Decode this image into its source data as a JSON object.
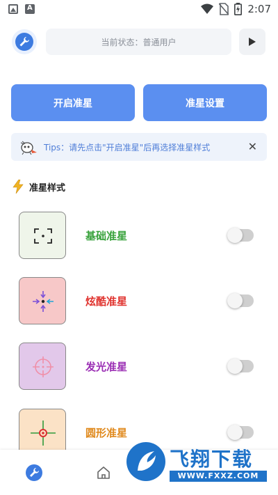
{
  "status_bar": {
    "time": "2:07",
    "icons": [
      "image-icon",
      "text-a-icon",
      "wifi-icon",
      "no-sim-icon",
      "battery-icon"
    ]
  },
  "top": {
    "status_text": "当前状态：普通用户"
  },
  "buttons": {
    "open": "开启准星",
    "settings": "准星设置"
  },
  "tips": {
    "text": "Tips：请先点击\"开启准星\"后再选择准星样式",
    "close": "✕"
  },
  "section": {
    "title": "准星样式"
  },
  "styles": [
    {
      "label": "基础准星",
      "color": "#38a23b",
      "thumb_bg": "#eff5ea",
      "enabled": false
    },
    {
      "label": "炫酷准星",
      "color": "#e0342f",
      "thumb_bg": "#f7c8c8",
      "enabled": false
    },
    {
      "label": "发光准星",
      "color": "#9b2fb4",
      "thumb_bg": "#e2c8ea",
      "enabled": false
    },
    {
      "label": "圆形准星",
      "color": "#e08a1e",
      "thumb_bg": "#fbe2c6",
      "enabled": false
    }
  ],
  "watermark": {
    "text": "飞翔下载",
    "url": "WWW.FXXZ.COM"
  },
  "colors": {
    "primary": "#5b8ff0",
    "accent": "#3d7be0"
  }
}
